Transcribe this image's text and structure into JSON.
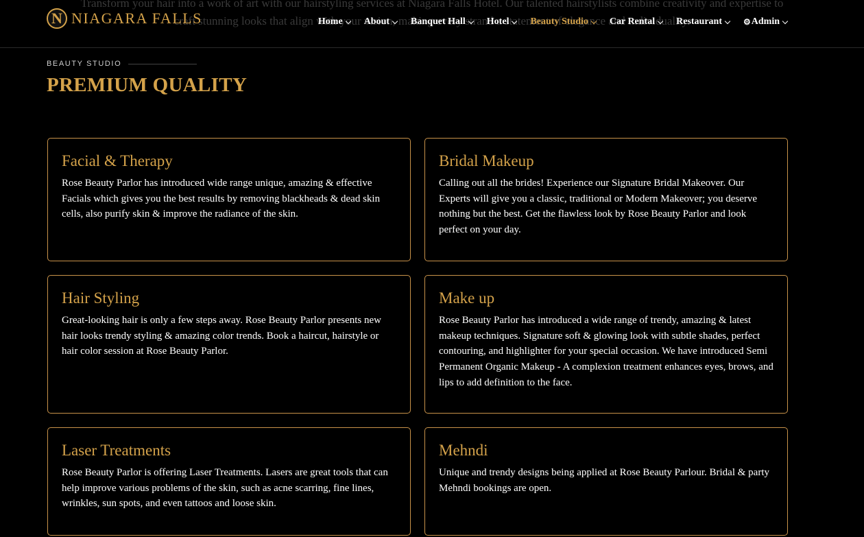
{
  "background_text": {
    "line1": "Transform your hair into a work of art with our hairstyling services at Niagara Falls Hotel. Our talented hairstylists combine creativity and expertise to",
    "line2": "craft stunning looks that align with your vision, making every strand a statement of elegance and individuality."
  },
  "brand": {
    "logo_letter": "N",
    "name": "NIAGARA FALLS"
  },
  "nav": {
    "items": [
      {
        "label": "Home"
      },
      {
        "label": "About"
      },
      {
        "label": "Banquet Hall"
      },
      {
        "label": "Hotel"
      },
      {
        "label": "Beauty Studio"
      },
      {
        "label": "Car Rental"
      },
      {
        "label": "Restaurant"
      },
      {
        "label": "Admin",
        "icon": "gear-icon"
      }
    ],
    "active": "Beauty Studio"
  },
  "section": {
    "kicker": "BEAUTY STUDIO",
    "title": "PREMIUM QUALITY"
  },
  "cards": [
    {
      "title": "Facial & Therapy",
      "text": "Rose Beauty Parlor has introduced wide range unique, amazing & effective Facials which gives you the best results by removing blackheads & dead skin cells, also purify skin & improve the radiance of the skin."
    },
    {
      "title": "Bridal Makeup",
      "text": "Calling out all the brides! Experience our Signature Bridal Makeover. Our Experts will give you a classic, traditional or Modern Makeover; you deserve nothing but the best. Get the flawless look by Rose Beauty Parlor and look perfect on your day."
    },
    {
      "title": "Hair Styling",
      "text": "Great-looking hair is only a few steps away. Rose Beauty Parlor presents new hair looks trendy styling & amazing color trends. Book a haircut, hairstyle or hair color session at Rose Beauty Parlor."
    },
    {
      "title": "Make up",
      "text": "Rose Beauty Parlor has introduced a wide range of trendy, amazing & latest makeup techniques. Signature soft & glowing look with subtle shades, perfect contouring, and highlighter for your special occasion. We have introduced Semi Permanent Organic Makeup - A complexion treatment enhances eyes, brows, and lips to add definition to the face."
    },
    {
      "title": "Laser Treatments",
      "text": "Rose Beauty Parlor is offering Laser Treatments. Lasers are great tools that can help improve various problems of the skin, such as acne scarring, fine lines, wrinkles, sun spots, and even tattoos and loose skin."
    },
    {
      "title": "Mehndi",
      "text": "Unique and trendy designs being applied at Rose Beauty Parlour. Bridal & party Mehndi bookings are open."
    }
  ],
  "colors": {
    "accent": "#d4a24a",
    "card_border": "#c9934a",
    "background": "#000000",
    "text": "#ffffff"
  }
}
